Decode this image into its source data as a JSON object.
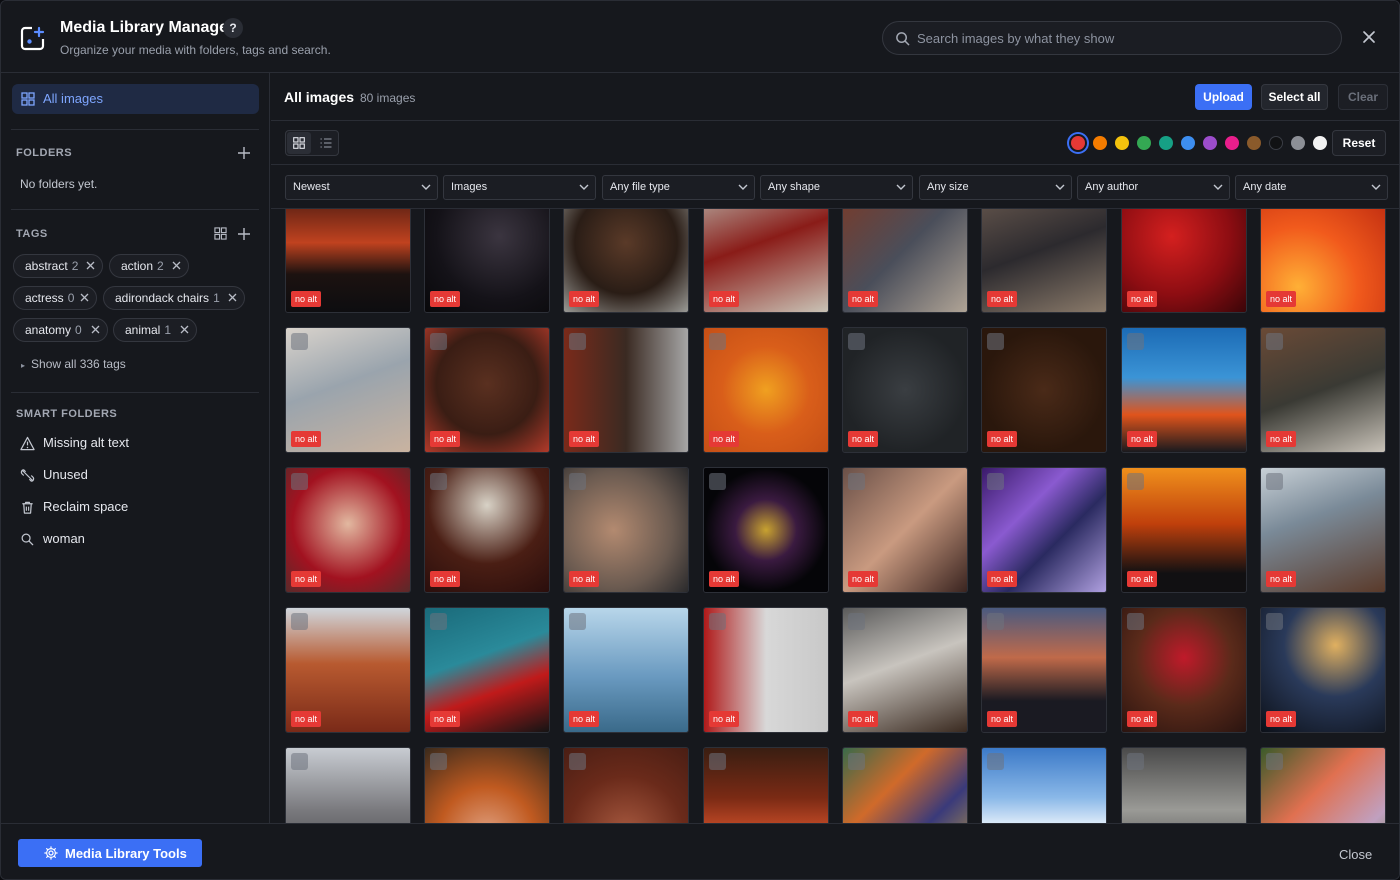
{
  "header": {
    "title": "Media Library Manager",
    "subtitle": "Organize your media with folders, tags and search.",
    "help_label": "?",
    "search_placeholder": "Search images by what they show"
  },
  "sidebar": {
    "all_images_label": "All images",
    "folders_title": "FOLDERS",
    "folders_empty": "No folders yet.",
    "tags_title": "TAGS",
    "tags": [
      {
        "name": "abstract",
        "count": "2"
      },
      {
        "name": "action",
        "count": "2"
      },
      {
        "name": "actress",
        "count": "0"
      },
      {
        "name": "adirondack chairs",
        "count": "1"
      },
      {
        "name": "anatomy",
        "count": "0"
      },
      {
        "name": "animal",
        "count": "1"
      }
    ],
    "show_all_tags": "Show all 336 tags",
    "smart_title": "SMART FOLDERS",
    "smart_folders": [
      {
        "label": "Missing alt text",
        "icon": "warning-icon"
      },
      {
        "label": "Unused",
        "icon": "unlink-icon"
      },
      {
        "label": "Reclaim space",
        "icon": "trash-icon"
      },
      {
        "label": "woman",
        "icon": "search-icon"
      }
    ]
  },
  "main": {
    "title": "All images",
    "count_label": "80 images",
    "upload_label": "Upload",
    "select_all_label": "Select all",
    "clear_label": "Clear",
    "reset_label": "Reset",
    "colors": [
      "#e53935",
      "#f57c00",
      "#f4c20d",
      "#34a853",
      "#16a085",
      "#3d8ef0",
      "#9c4dcc",
      "#e91e8c",
      "#8a5a2b",
      "#111214",
      "#8c8f96",
      "#f2f2f2"
    ],
    "filters": [
      "Newest",
      "Images",
      "Any file type",
      "Any shape",
      "Any size",
      "Any author",
      "Any date"
    ],
    "no_alt_label": "no alt"
  },
  "footer": {
    "tools_label": "Media Library Tools",
    "close_label": "Close"
  }
}
